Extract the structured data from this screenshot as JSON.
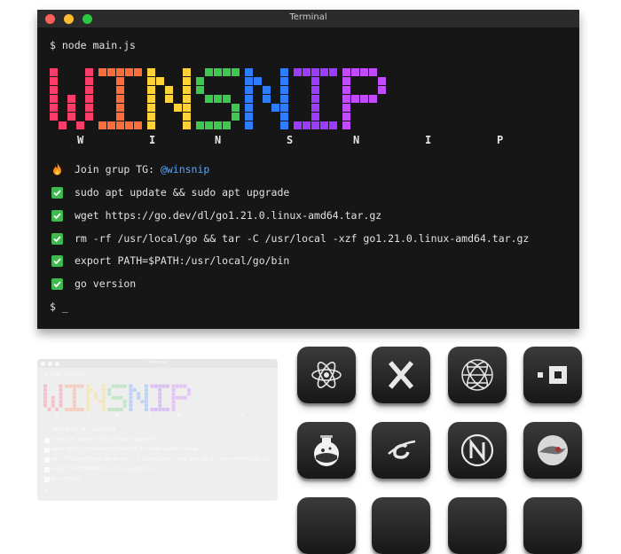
{
  "window": {
    "title": "Terminal"
  },
  "terminal": {
    "command": "$ node main.js",
    "logo_text": "WINSNIP",
    "spaced_letters": [
      "W",
      "I",
      "N",
      "S",
      "N",
      "I",
      "P"
    ],
    "logo_colors": [
      "#fc3d6a",
      "#ff6d3b",
      "#ffd23a",
      "#3fc752",
      "#2f7dff",
      "#9b3cff",
      "#c24bff"
    ],
    "join_label": "Join grup TG: ",
    "join_handle": "@winsnip",
    "steps": [
      "sudo apt update && sudo apt upgrade",
      "wget https://go.dev/dl/go1.21.0.linux-amd64.tar.gz",
      "rm -rf /usr/local/go && tar -C /usr/local -xzf go1.21.0.linux-amd64.tar.gz",
      "export PATH=$PATH:/usr/local/go/bin",
      "go version"
    ],
    "prompt": "$ _"
  },
  "preview": {
    "command": "$ node main.js",
    "join": "Join grup TG: @winsnip"
  },
  "icons": [
    "atom-icon",
    "x-icon",
    "globe-icon",
    "square-dot-icon",
    "flask-icon",
    "planet-icon",
    "n-circle-icon",
    "nebula-icon"
  ],
  "accent": {
    "check": "#3fb950",
    "link": "#58a6ff"
  }
}
